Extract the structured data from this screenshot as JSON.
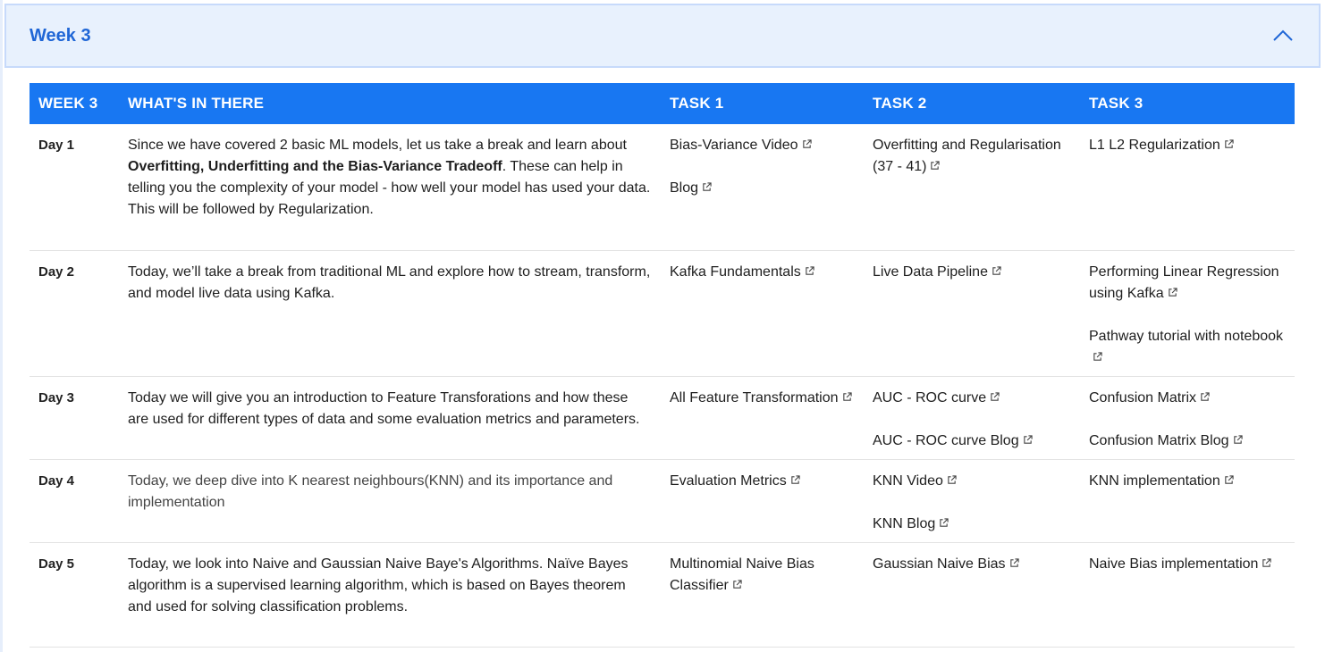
{
  "accordion": {
    "title": "Week 3",
    "expanded_icon": "chevron-up-icon"
  },
  "table": {
    "headers": [
      "WEEK 3",
      "WHAT'S IN THERE",
      "TASK 1",
      "TASK 2",
      "TASK 3"
    ],
    "rows": [
      {
        "day": "Day 1",
        "desc_parts": [
          {
            "text": "Since we have covered 2 basic ML models, let us take a break and learn about ",
            "bold": false
          },
          {
            "text": "Overfitting, Underfitting and the Bias-Variance Tradeoff",
            "bold": true
          },
          {
            "text": ". These can help in telling you the complexity of your model - how well your model has used your data. This will be followed by Regularization.",
            "bold": false
          }
        ],
        "task1": [
          "Bias-Variance Video",
          "Blog"
        ],
        "task2": [
          "Overfitting and Regularisation (37 - 41)"
        ],
        "task3": [
          "L1 L2 Regularization"
        ]
      },
      {
        "day": "Day 2",
        "desc_parts": [
          {
            "text": "Today, we’ll take a break from traditional ML and explore how to stream, transform, and model live data using Kafka.",
            "bold": false
          }
        ],
        "task1": [
          "Kafka Fundamentals"
        ],
        "task2": [
          "Live Data Pipeline"
        ],
        "task3": [
          "Performing Linear Regression using Kafka",
          "Pathway tutorial with notebook"
        ]
      },
      {
        "day": "Day 3",
        "desc_parts": [
          {
            "text": "Today we will give you an introduction to Feature Transforations and how these are used for different types of data and some evaluation metrics and parameters.",
            "bold": false
          }
        ],
        "task1": [
          "All Feature Transformation"
        ],
        "task2": [
          "AUC - ROC curve",
          "AUC - ROC curve Blog"
        ],
        "task3": [
          "Confusion Matrix",
          "Confusion Matrix Blog"
        ]
      },
      {
        "day": "Day 4",
        "muted": true,
        "desc_parts": [
          {
            "text": "Today, we deep dive into K nearest neighbours(KNN) and its importance and implementation",
            "bold": false
          }
        ],
        "task1": [
          "Evaluation Metrics"
        ],
        "task2": [
          "KNN Video",
          "KNN Blog"
        ],
        "task3": [
          "KNN implementation"
        ]
      },
      {
        "day": "Day 5",
        "desc_parts": [
          {
            "text": "Today, we look into Naive and Gaussian Naive Baye's Algorithms. Naïve Bayes algorithm is a supervised learning algorithm, which is based on Bayes theorem and used for solving classification problems.",
            "bold": false
          }
        ],
        "task1": [
          "Multinomial Naive Bias Classifier"
        ],
        "task2": [
          "Gaussian Naive Bias"
        ],
        "task3": [
          "Naive Bias implementation"
        ]
      }
    ]
  },
  "colors": {
    "accent": "#1877f2",
    "title": "#1f66d6",
    "header_bg": "#e8f1fd"
  }
}
